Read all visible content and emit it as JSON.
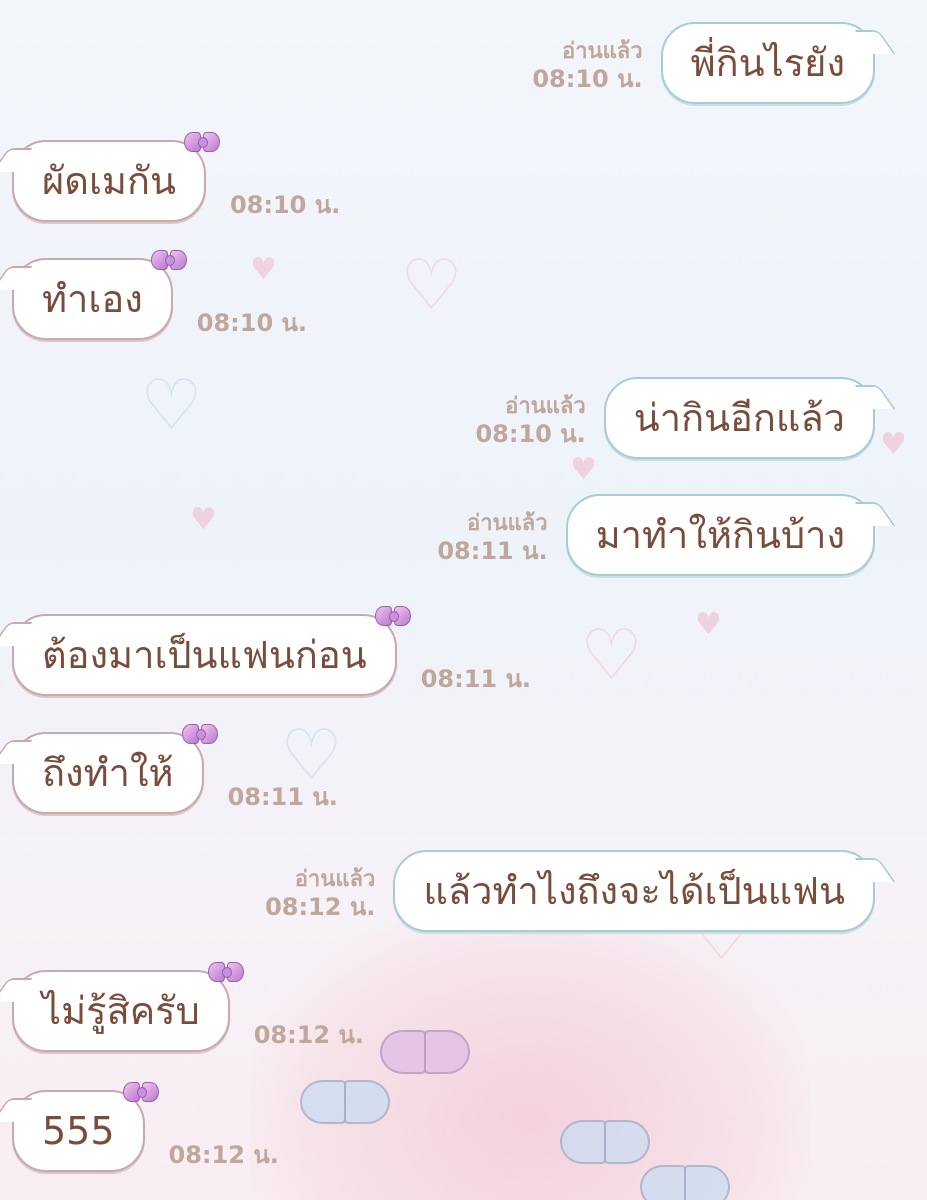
{
  "messages": [
    {
      "side": "sent",
      "text": "พี่กินไรยัง",
      "read": "อ่านแล้ว",
      "time": "08:10 น."
    },
    {
      "side": "received",
      "text": "ผัดเมกัน",
      "time": "08:10 น."
    },
    {
      "side": "received",
      "text": "ทำเอง",
      "time": "08:10 น."
    },
    {
      "side": "sent",
      "text": "น่ากินอีกแล้ว",
      "read": "อ่านแล้ว",
      "time": "08:10 น."
    },
    {
      "side": "sent",
      "text": "มาทำให้กินบ้าง",
      "read": "อ่านแล้ว",
      "time": "08:11 น."
    },
    {
      "side": "received",
      "text": "ต้องมาเป็นแฟนก่อน",
      "time": "08:11 น."
    },
    {
      "side": "received",
      "text": "ถึงทำให้",
      "time": "08:11 น."
    },
    {
      "side": "sent",
      "text": "แล้วทำไงถึงจะได้เป็นแฟน",
      "read": "อ่านแล้ว",
      "time": "08:12 น."
    },
    {
      "side": "received",
      "text": "ไม่รู้สิครับ",
      "time": "08:12 น."
    },
    {
      "side": "received",
      "text": "555",
      "time": "08:12 น."
    }
  ],
  "colors": {
    "text": "#7a4c3c",
    "meta": "#c0a79c",
    "sent_border": "#a8ccd4",
    "received_border": "#c7a9ae"
  },
  "icons": {
    "received_bubble_decoration": "ribbon-bow-icon"
  }
}
